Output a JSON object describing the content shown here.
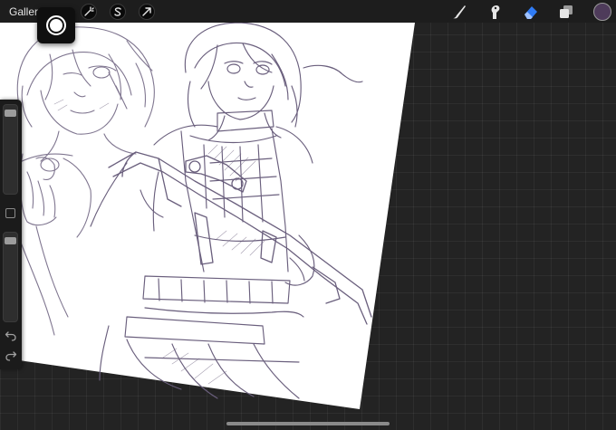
{
  "app": {
    "gallery_label": "Gallery"
  },
  "toolbar": {
    "left_tools": [
      "adjustments-wand-icon",
      "selection-s-icon",
      "transform-arrow-icon"
    ],
    "right_tools": [
      "brush-icon",
      "smudge-icon",
      "eraser-icon",
      "layers-icon"
    ],
    "active_tool": "eraser-icon",
    "current_color": "#4e3b5a",
    "active_tool_color": "#2f7bf5"
  },
  "sidebar": {
    "brush_size": 0.95,
    "brush_opacity": 0.95
  },
  "canvas": {
    "background": "#232323",
    "paper": "#ffffff",
    "ink": "#6a5f7d"
  }
}
